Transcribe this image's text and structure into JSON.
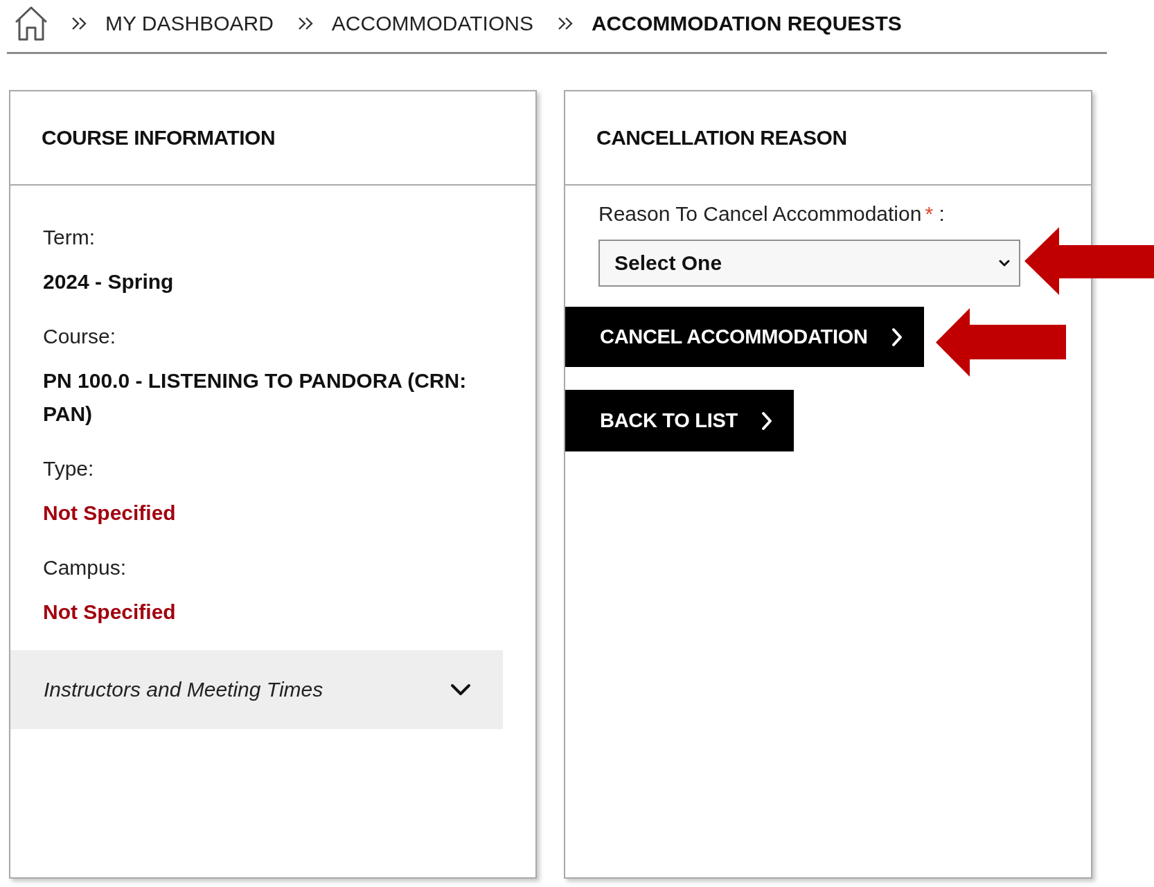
{
  "breadcrumb": [
    {
      "label": "MY DASHBOARD",
      "current": false
    },
    {
      "label": "ACCOMMODATIONS",
      "current": false
    },
    {
      "label": "ACCOMMODATION REQUESTS",
      "current": true
    }
  ],
  "course_panel": {
    "title": "COURSE INFORMATION",
    "fields": [
      {
        "label": "Term:",
        "value": "2024 - Spring",
        "kind": "plain"
      },
      {
        "label": "Course:",
        "value": "PN 100.0 - LISTENING TO PANDORA (CRN: PAN)",
        "kind": "plain"
      },
      {
        "label": "Type:",
        "value": "Not Specified",
        "kind": "unset"
      },
      {
        "label": "Campus:",
        "value": "Not Specified",
        "kind": "unset"
      }
    ],
    "accordion": {
      "label": "Instructors and Meeting Times",
      "expanded": false
    }
  },
  "cancellation_panel": {
    "title": "CANCELLATION REASON",
    "reason_field": {
      "label": "Reason To Cancel Accommodation",
      "required_mark": "*",
      "suffix": ":",
      "value": "Select One"
    },
    "buttons": [
      {
        "label": "CANCEL ACCOMMODATION"
      },
      {
        "label": "BACK TO LIST"
      }
    ]
  }
}
